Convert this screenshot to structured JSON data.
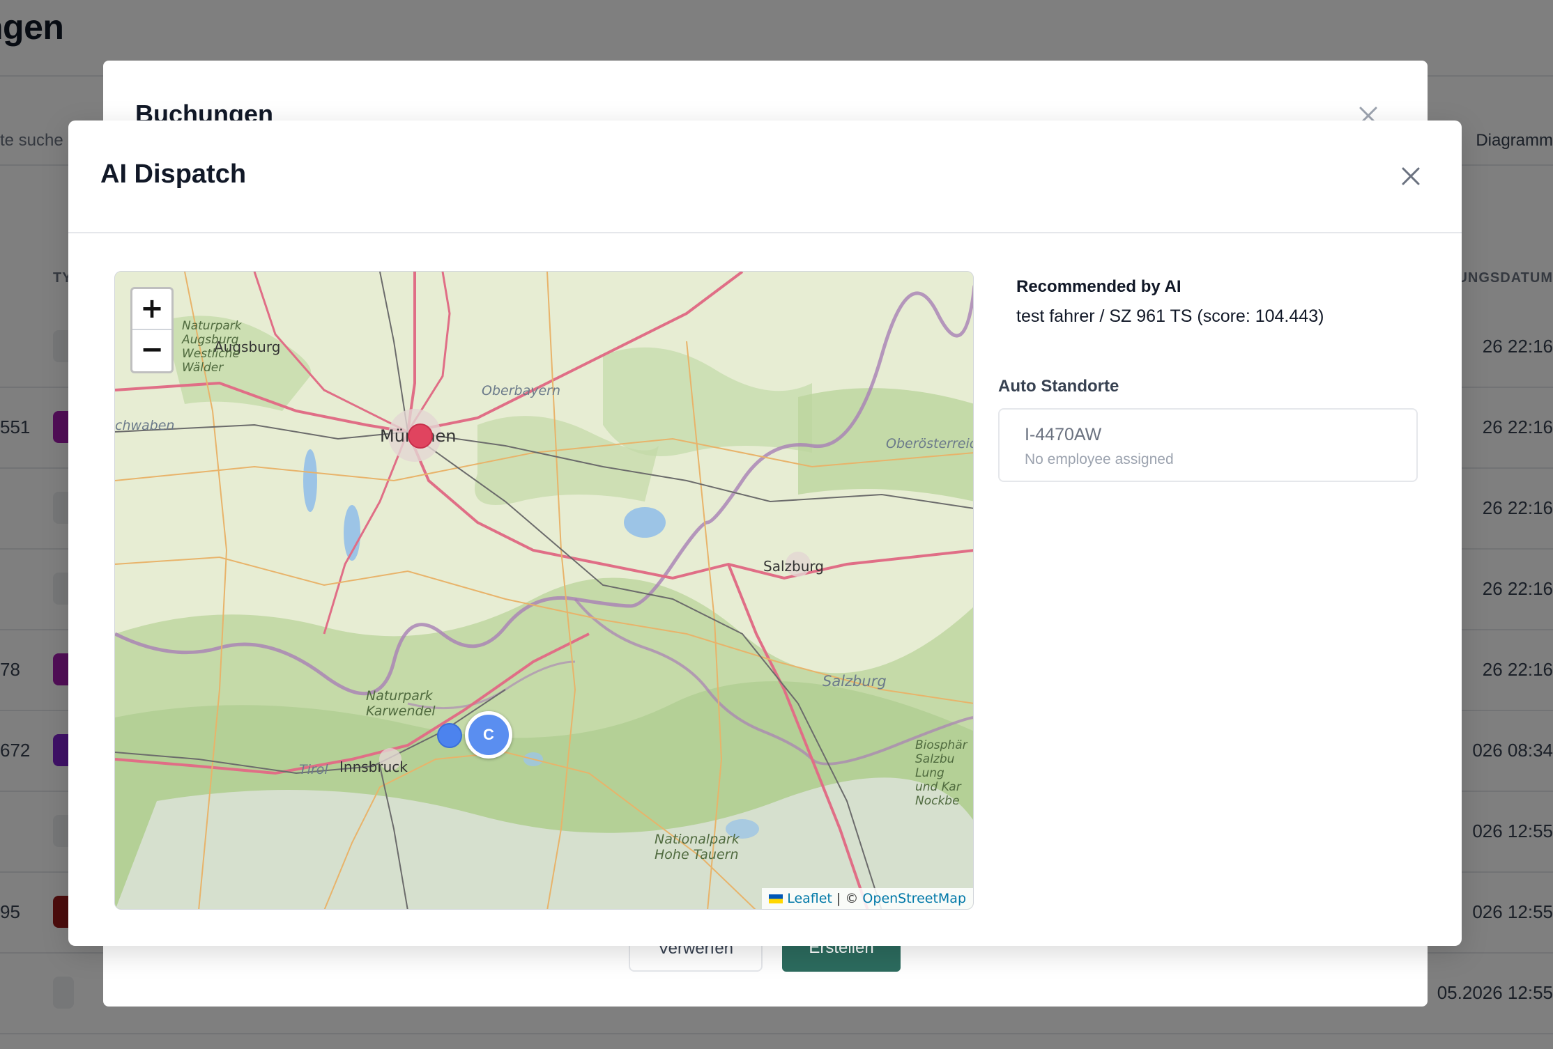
{
  "background": {
    "title": "ngen",
    "search_placeholder": "te suche",
    "diagram_label": "Diagramm",
    "col_type": "TY",
    "col_date": "UNGSDATUM",
    "rows": [
      {
        "left": "",
        "date": "26 22:16",
        "pill": ""
      },
      {
        "left": "551",
        "date": "26 22:16",
        "pill": "#a21caf"
      },
      {
        "left": "",
        "date": "26 22:16",
        "pill": ""
      },
      {
        "left": "",
        "date": "26 22:16",
        "pill": ""
      },
      {
        "left": "78",
        "date": "26 22:16",
        "pill": "#a21caf"
      },
      {
        "left": "672",
        "date": "026 08:34",
        "pill": "#7e22ce"
      },
      {
        "left": "",
        "date": "026 12:55",
        "pill": ""
      },
      {
        "left": "95",
        "date": "026 12:55",
        "pill": "#991b1b"
      },
      {
        "left": "",
        "date": "05.2026 12:55",
        "pill": ""
      }
    ]
  },
  "buchungen_modal": {
    "title": "Buchungen",
    "discard_label": "Verwerfen",
    "create_label": "Erstellen"
  },
  "dispatch_modal": {
    "title": "AI Dispatch",
    "recommended_title": "Recommended by AI",
    "recommended_value": "test fahrer / SZ 961 TS (score: 104.443)",
    "auto_standorte_label": "Auto Standorte",
    "vehicles": [
      {
        "plate": "I-4470AW",
        "status": "No employee assigned"
      }
    ]
  },
  "map": {
    "zoom_in": "+",
    "zoom_out": "−",
    "cluster_label": "C",
    "labels": {
      "augsburg": "Augsburg",
      "muenchen": "München",
      "oberbayern": "Oberbayern",
      "schwaben": "chwaben",
      "oberoesterreich": "Oberösterreic",
      "salzburg_city": "Salzburg",
      "salzburg_region": "Salzburg",
      "innsbruck": "Innsbruck",
      "tirol": "Tirol",
      "karwendel": "Naturpark\nKarwendel",
      "hohe_tauern": "Nationalpark\nHohe Tauern",
      "augsburg_park": "Naturpark\nAugsburg\nWestliche\nWälder",
      "biosphaere": "Biosphär\nSalzbu\nLung\nund Kar\nNockbe"
    },
    "attribution_leaflet": "Leaflet",
    "attribution_sep": " | © ",
    "attribution_osm": "OpenStreetMap"
  }
}
